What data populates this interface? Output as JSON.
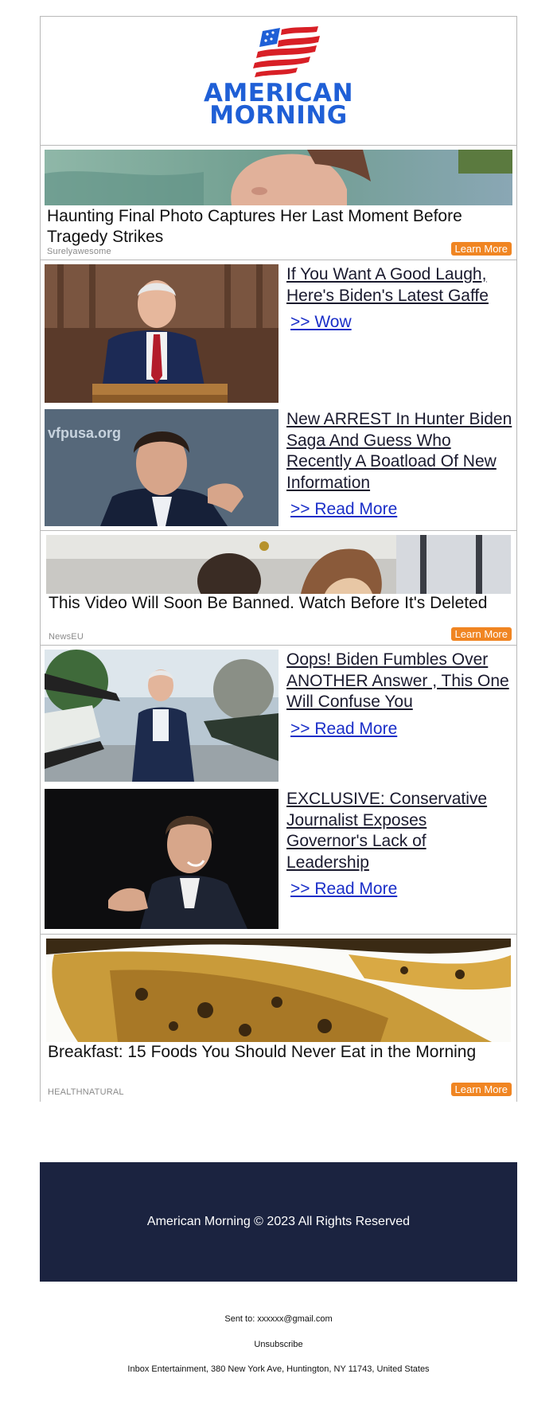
{
  "brand": {
    "name_line1": "AMERICAN",
    "name_line2": "MORNING",
    "flag_colors": {
      "red": "#d81f26",
      "blue": "#1f5fd6"
    }
  },
  "ads": [
    {
      "title": "Haunting Final Photo Captures Her Last Moment Before Tragedy Strikes",
      "source": "Surelyawesome",
      "button": "Learn More"
    },
    {
      "title": "This Video Will Soon Be Banned. Watch Before It's Deleted",
      "source": "NewsEU",
      "button": "Learn More"
    },
    {
      "title": "Breakfast: 15 Foods You Should Never Eat in the Morning",
      "source": "HEALTHNATURAL",
      "button": "Learn More"
    }
  ],
  "articles": [
    {
      "headline": "If You Want A Good Laugh, Here's Biden's Latest Gaffe",
      "link": ">> Wow"
    },
    {
      "headline": "New ARREST In Hunter Biden Saga And Guess Who Recently A Boatload Of New Information",
      "link": ">> Read More"
    },
    {
      "headline": "Oops! Biden Fumbles Over ANOTHER Answer , This One Will Confuse You",
      "link": ">> Read More"
    },
    {
      "headline": "EXCLUSIVE: Conservative Journalist Exposes Governor's Lack of Leadership",
      "link": ">> Read More"
    }
  ],
  "footer": {
    "copyright": "American Morning © 2023 All Rights Reserved",
    "sent_to": "Sent to: xxxxxx@gmail.com",
    "unsubscribe": "Unsubscribe",
    "address": "Inbox Entertainment, 380 New York Ave, Huntington, NY 11743, United States"
  },
  "colors": {
    "accent_orange": "#f08522",
    "footer_navy": "#1b2340",
    "link_blue": "#1a2ec8"
  }
}
